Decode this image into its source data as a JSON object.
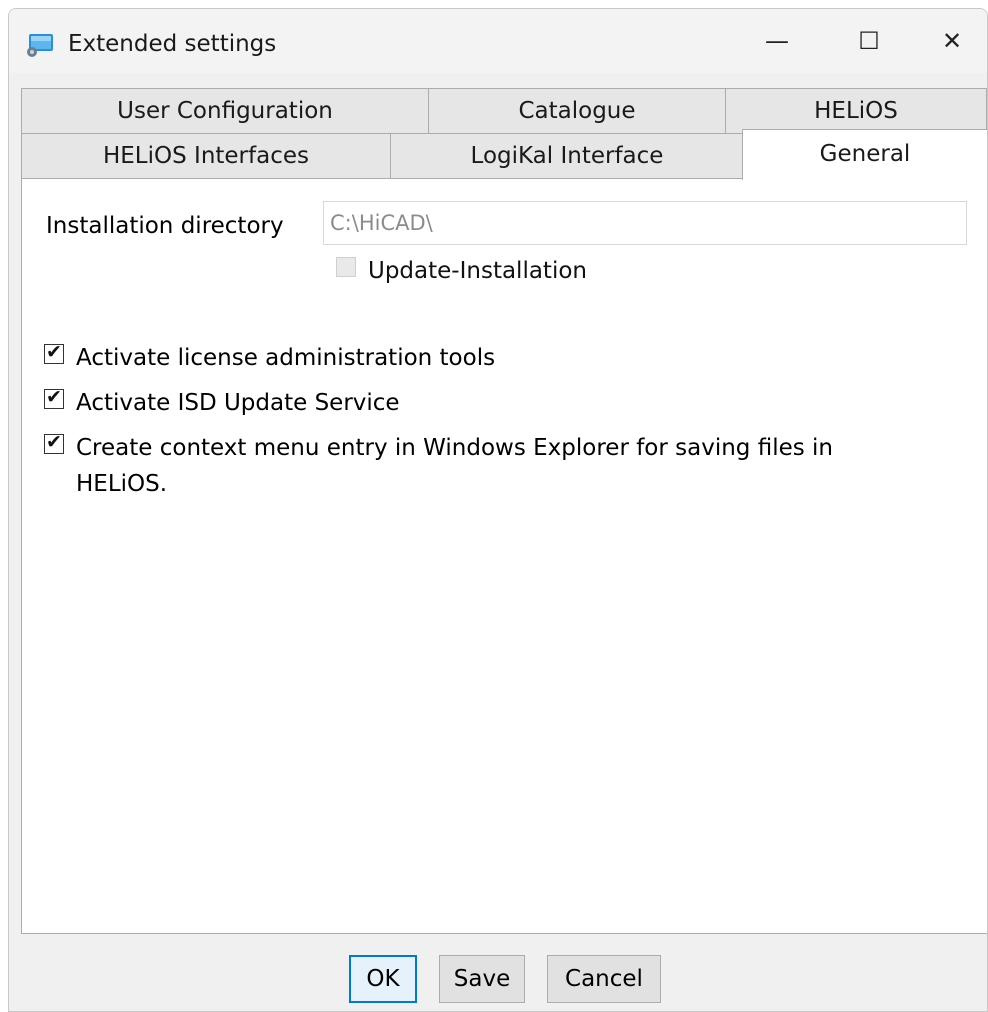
{
  "window": {
    "title": "Extended settings",
    "minimize_glyph": "—",
    "maximize_glyph": "☐",
    "close_glyph": "✕",
    "app_icon": "hicad-window-icon"
  },
  "tabs": {
    "row1": [
      {
        "label": "User Configuration",
        "name": "tab-user-configuration"
      },
      {
        "label": "Catalogue",
        "name": "tab-catalogue"
      },
      {
        "label": "HELiOS",
        "name": "tab-helios"
      }
    ],
    "row2": [
      {
        "label": "HELiOS Interfaces",
        "name": "tab-helios-interfaces"
      },
      {
        "label": "LogiKal Interface",
        "name": "tab-logikal-interface"
      },
      {
        "label": "General",
        "name": "tab-general",
        "selected": true
      }
    ]
  },
  "general": {
    "install_dir_label": "Installation directory",
    "install_dir_value": "C:\\HiCAD\\",
    "update_installation": {
      "label": "Update-Installation",
      "checked": false,
      "enabled": false
    },
    "options": [
      {
        "label": "Activate license administration tools",
        "checked": true
      },
      {
        "label": "Activate ISD Update Service",
        "checked": true
      },
      {
        "label": "Create context menu entry in Windows Explorer for saving files in",
        "label_line2": "HELiOS.",
        "checked": true
      }
    ]
  },
  "buttons": {
    "ok": "OK",
    "save": "Save",
    "cancel": "Cancel"
  },
  "colors": {
    "accent": "#0078d7",
    "window_bg": "#f0f0f0",
    "panel_bg": "#ffffff"
  }
}
